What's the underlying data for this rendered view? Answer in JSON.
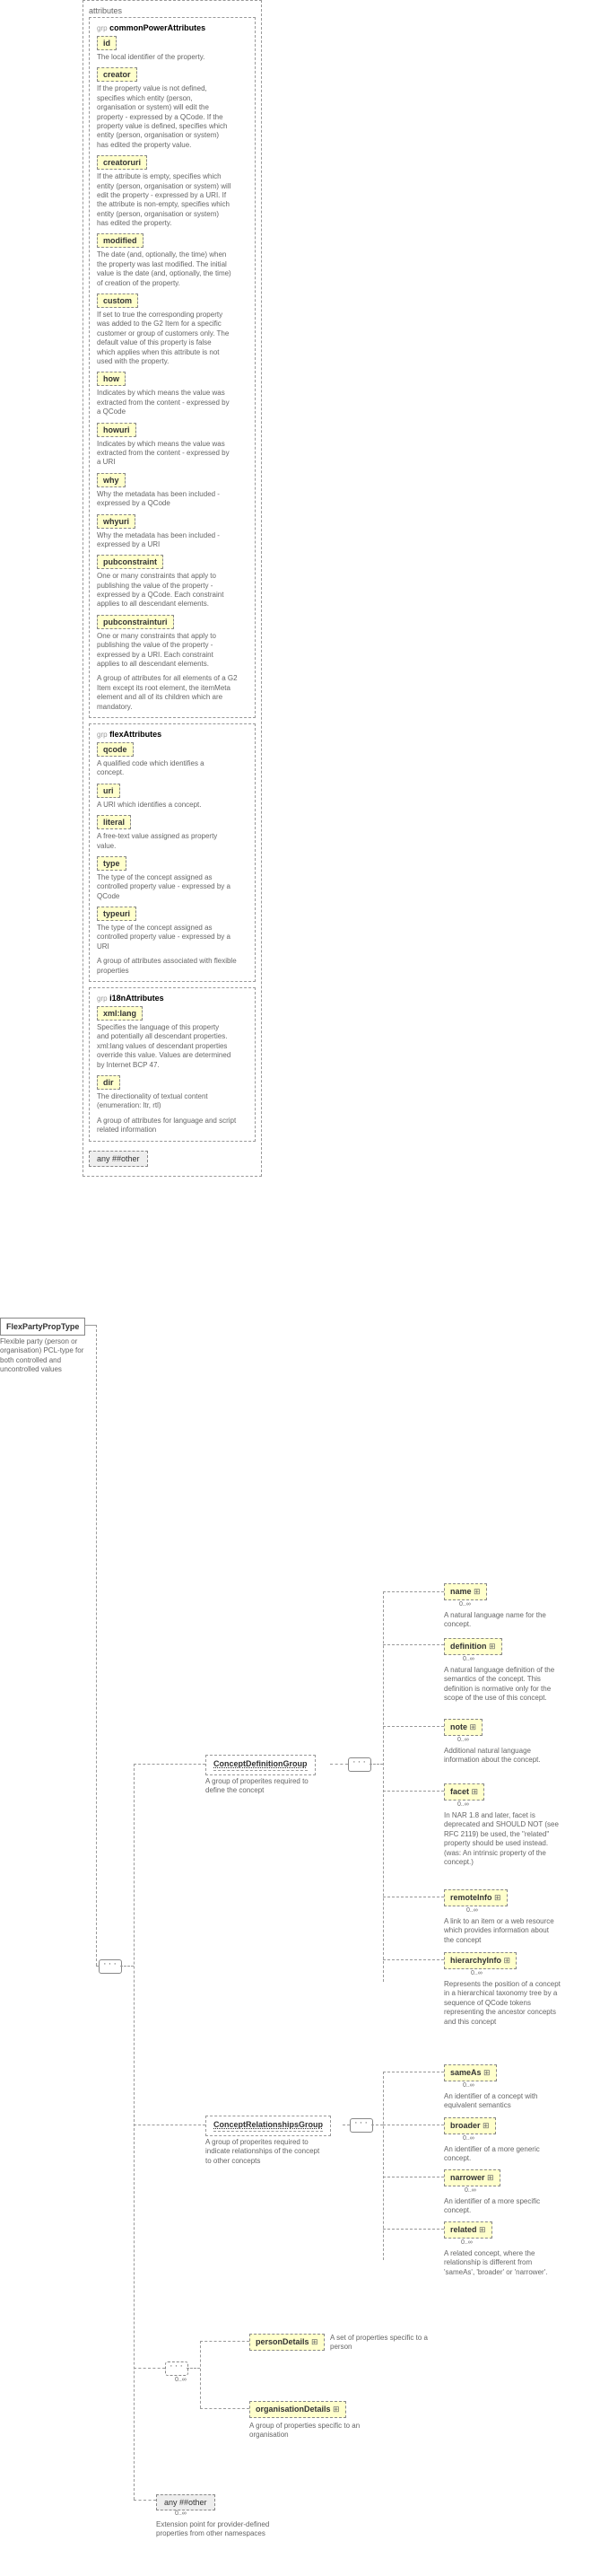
{
  "root": {
    "name": "FlexPartyPropType",
    "desc": "Flexible party (person or organisation) PCL-type for both controlled and uncontrolled values"
  },
  "attrs_label": "attributes",
  "groups": {
    "common": {
      "title": "commonPowerAttributes",
      "desc": "A group of attributes for all elements of a G2 Item except its root element, the itemMeta element and all of its children which are mandatory.",
      "prefix": "grp",
      "items": [
        {
          "name": "id",
          "desc": "The local identifier of the property."
        },
        {
          "name": "creator",
          "desc": "If the property value is not defined, specifies which entity (person, organisation or system) will edit the property - expressed by a QCode. If the property value is defined, specifies which entity (person, organisation or system) has edited the property value."
        },
        {
          "name": "creatoruri",
          "desc": "If the attribute is empty, specifies which entity (person, organisation or system) will edit the property - expressed by a URI. If the attribute is non-empty, specifies which entity (person, organisation or system) has edited the property."
        },
        {
          "name": "modified",
          "desc": "The date (and, optionally, the time) when the property was last modified. The initial value is the date (and, optionally, the time) of creation of the property."
        },
        {
          "name": "custom",
          "desc": "If set to true the corresponding property was added to the G2 Item for a specific customer or group of customers only. The default value of this property is false which applies when this attribute is not used with the property."
        },
        {
          "name": "how",
          "desc": "Indicates by which means the value was extracted from the content - expressed by a QCode"
        },
        {
          "name": "howuri",
          "desc": "Indicates by which means the value was extracted from the content - expressed by a URI"
        },
        {
          "name": "why",
          "desc": "Why the metadata has been included - expressed by a QCode"
        },
        {
          "name": "whyuri",
          "desc": "Why the metadata has been included - expressed by a URI"
        },
        {
          "name": "pubconstraint",
          "desc": "One or many constraints that apply to publishing the value of the property - expressed by a QCode. Each constraint applies to all descendant elements."
        },
        {
          "name": "pubconstrainturi",
          "desc": "One or many constraints that apply to publishing the value of the property - expressed by a URI. Each constraint applies to all descendant elements."
        }
      ]
    },
    "flex": {
      "title": "flexAttributes",
      "desc": "A group of attributes associated with flexible properties",
      "prefix": "grp",
      "items": [
        {
          "name": "qcode",
          "desc": "A qualified code which identifies a concept."
        },
        {
          "name": "uri",
          "desc": "A URI which identifies a concept."
        },
        {
          "name": "literal",
          "desc": "A free-text value assigned as property value."
        },
        {
          "name": "type",
          "desc": "The type of the concept assigned as controlled property value - expressed by a QCode"
        },
        {
          "name": "typeuri",
          "desc": "The type of the concept assigned as controlled property value - expressed by a URI"
        }
      ]
    },
    "i18n": {
      "title": "i18nAttributes",
      "desc": "A group of attributes for language and script related information",
      "prefix": "grp",
      "items": [
        {
          "name": "xml:lang",
          "desc": "Specifies the language of this property and potentially all descendant properties. xml:lang values of descendant properties override this value. Values are determined by Internet BCP 47."
        },
        {
          "name": "dir",
          "desc": "The directionality of textual content (enumeration: ltr, rtl)"
        }
      ]
    }
  },
  "any_other": "any ##other",
  "mainGroups": {
    "cdef": {
      "title": "ConceptDefinitionGroup",
      "desc": "A group of properites required to define the concept"
    },
    "crel": {
      "title": "ConceptRelationshipsGroup",
      "desc": "A group of properites required to indicate relationships of the concept to other concepts"
    }
  },
  "elems": {
    "name": {
      "label": "name",
      "desc": "A natural language name for the concept."
    },
    "definition": {
      "label": "definition",
      "desc": "A natural language definition of the semantics of the concept. This definition is normative only for the scope of the use of this concept."
    },
    "note": {
      "label": "note",
      "desc": "Additional natural language information about the concept."
    },
    "facet": {
      "label": "facet",
      "desc": "In NAR 1.8 and later, facet is deprecated and SHOULD NOT (see RFC 2119) be used, the \"related\" property should be used instead. (was: An intrinsic property of the concept.)"
    },
    "remoteInfo": {
      "label": "remoteInfo",
      "desc": "A link to an item or a web resource which provides information about the concept"
    },
    "hierarchyInfo": {
      "label": "hierarchyInfo",
      "desc": "Represents the position of a concept in a hierarchical taxonomy tree by a sequence of QCode tokens representing the ancestor concepts and this concept"
    },
    "sameAs": {
      "label": "sameAs",
      "desc": "An identifier of a concept with equivalent semantics"
    },
    "broader": {
      "label": "broader",
      "desc": "An identifier of a more generic concept."
    },
    "narrower": {
      "label": "narrower",
      "desc": "An identifier of a more specific concept."
    },
    "related": {
      "label": "related",
      "desc": "A related concept, where the relationship is different from 'sameAs', 'broader' or 'narrower'."
    },
    "personDetails": {
      "label": "personDetails",
      "desc": "A set of properties specific to a person"
    },
    "organisationDetails": {
      "label": "organisationDetails",
      "desc": "A group of properties specific to an organisation"
    }
  },
  "bottom_other": {
    "label": "any ##other",
    "card": "0..∞",
    "desc": "Extension point for provider-defined properties from other namespaces"
  },
  "card_inf": "0..∞"
}
